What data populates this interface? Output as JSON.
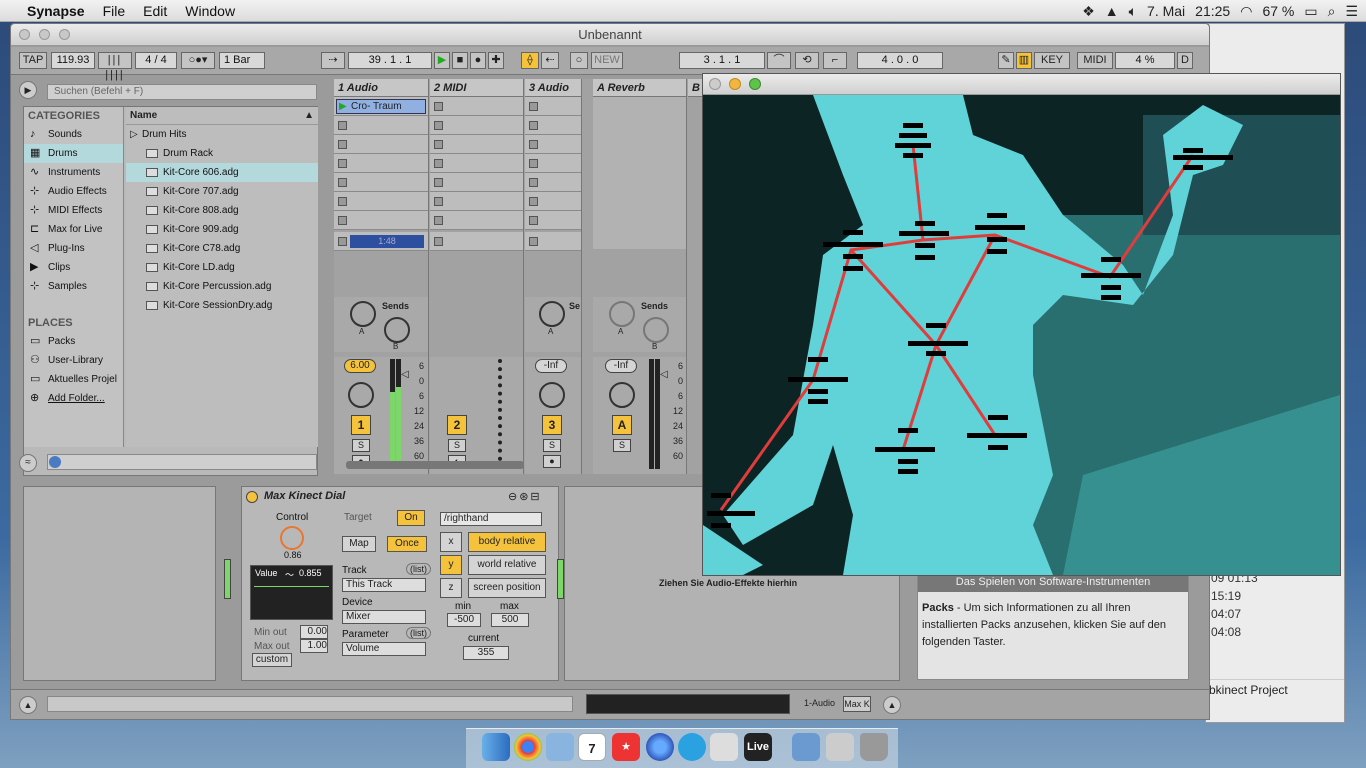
{
  "menubar": {
    "apple": "",
    "app": "Synapse",
    "items": [
      "File",
      "Edit",
      "Window"
    ],
    "date": "7. Mai",
    "time": "21:25",
    "battery": "67 %"
  },
  "live": {
    "title": "Unbenannt",
    "transport": {
      "tap": "TAP",
      "tempo": "119.93",
      "sig": "4 / 4",
      "quant": "1 Bar",
      "position": "39 .  1 .  1",
      "new": "NEW",
      "loop_start": "3 .  1 .  1",
      "loop_len": "4 .  0 .  0",
      "key": "KEY",
      "midi": "MIDI",
      "cpu": "4 %",
      "d": "D"
    },
    "browser": {
      "search_placeholder": "Suchen (Befehl + F)",
      "categories_header": "CATEGORIES",
      "categories": [
        {
          "label": "Sounds",
          "icon": "♪"
        },
        {
          "label": "Drums",
          "icon": "▦"
        },
        {
          "label": "Instruments",
          "icon": "∿"
        },
        {
          "label": "Audio Effects",
          "icon": "⊹"
        },
        {
          "label": "MIDI Effects",
          "icon": "⊹"
        },
        {
          "label": "Max for Live",
          "icon": "⊏"
        },
        {
          "label": "Plug-Ins",
          "icon": "◁"
        },
        {
          "label": "Clips",
          "icon": "▶"
        },
        {
          "label": "Samples",
          "icon": "⊹"
        }
      ],
      "places_header": "PLACES",
      "places": [
        {
          "label": "Packs",
          "icon": "▭"
        },
        {
          "label": "User-Library",
          "icon": "⚇"
        },
        {
          "label": "Aktuelles Projel",
          "icon": "▭"
        },
        {
          "label": "Add Folder...",
          "icon": "⊕"
        }
      ],
      "name_header": "Name",
      "files": [
        "Drum Hits",
        "Drum Rack",
        "Kit-Core 606.adg",
        "Kit-Core 707.adg",
        "Kit-Core 808.adg",
        "Kit-Core 909.adg",
        "Kit-Core C78.adg",
        "Kit-Core LD.adg",
        "Kit-Core Percussion.adg",
        "Kit-Core SessionDry.adg"
      ]
    },
    "tracks": [
      {
        "name": "1 Audio",
        "clip": "Cro- Traum",
        "sends": "Sends",
        "vol": "6.00",
        "num": "1",
        "solo": "S",
        "meter": [
          "6",
          "0",
          "6",
          "12",
          "24",
          "36",
          "60"
        ],
        "clipbar": "1:48"
      },
      {
        "name": "2 MIDI",
        "num": "2",
        "solo": "S"
      },
      {
        "name": "3 Audio",
        "sends": "Se",
        "vol": "-Inf",
        "num": "3",
        "solo": "S"
      },
      {
        "name": "A Reverb",
        "sends": "Sends",
        "vol": "-Inf",
        "num": "A",
        "solo": "S",
        "meter": [
          "6",
          "0",
          "6",
          "12",
          "24",
          "36",
          "60"
        ]
      },
      {
        "name": "B D"
      }
    ],
    "send_labels": {
      "a": "A",
      "b": "B"
    },
    "device": {
      "title": "Max Kinect Dial",
      "control": "Control",
      "control_val": "0.86",
      "target": "Target",
      "on": "On",
      "map": "Map",
      "once": "Once",
      "value_label": "Value",
      "value": "0.855",
      "min_out_label": "Min out",
      "min_out": "0.00",
      "max_out_label": "Max out",
      "max_out": "1.00",
      "custom": "custom",
      "track_label": "Track",
      "track": "This Track",
      "list": "(list)",
      "device_label": "Device",
      "device": "Mixer",
      "param_label": "Parameter",
      "param": "Volume",
      "joint": "/righthand",
      "x": "x",
      "y": "y",
      "z": "z",
      "body_relative": "body relative",
      "world_relative": "world relative",
      "screen_position": "screen position",
      "min_label": "min",
      "min": "-500",
      "max_label": "max",
      "max": "500",
      "current_label": "current",
      "current": "355"
    },
    "drop_hint": "Ziehen Sie Audio-Effekte hierhin",
    "info": {
      "heading": "Das Spielen von Software-Instrumenten",
      "bold": "Packs",
      "text": " - Um sich Informationen zu all Ihren installierten Packs anzusehen, klicken Sie auf den folgenden Taster."
    },
    "status": {
      "track": "1-Audio",
      "device": "Max K"
    }
  },
  "rightwin": {
    "times": [
      "09 01:13",
      "15:19",
      "04:07",
      "04:08"
    ],
    "project": "bkinect Project"
  },
  "dock": {
    "live_label": "Live",
    "calendar_day": "7"
  }
}
